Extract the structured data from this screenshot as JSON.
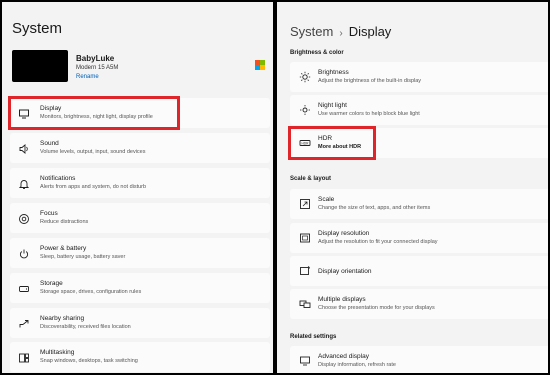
{
  "left": {
    "title": "System",
    "device": {
      "name": "BabyLuke",
      "model": "Modern 15 A5M",
      "rename": "Rename"
    },
    "items": [
      {
        "title": "Display",
        "subtitle": "Monitors, brightness, night light, display profile",
        "icon": "monitor-icon"
      },
      {
        "title": "Sound",
        "subtitle": "Volume levels, output, input, sound devices",
        "icon": "speaker-icon"
      },
      {
        "title": "Notifications",
        "subtitle": "Alerts from apps and system, do not disturb",
        "icon": "bell-icon"
      },
      {
        "title": "Focus",
        "subtitle": "Reduce distractions",
        "icon": "focus-icon"
      },
      {
        "title": "Power & battery",
        "subtitle": "Sleep, battery usage, battery saver",
        "icon": "power-icon"
      },
      {
        "title": "Storage",
        "subtitle": "Storage space, drives, configuration rules",
        "icon": "storage-icon"
      },
      {
        "title": "Nearby sharing",
        "subtitle": "Discoverability, received files location",
        "icon": "share-icon"
      },
      {
        "title": "Multitasking",
        "subtitle": "Snap windows, desktops, task switching",
        "icon": "multitask-icon"
      }
    ]
  },
  "right": {
    "breadcrumb": {
      "parent": "System",
      "separator": "›",
      "current": "Display"
    },
    "sections": {
      "brightness": "Brightness & color",
      "scale": "Scale & layout",
      "related": "Related settings"
    },
    "brightness_items": [
      {
        "title": "Brightness",
        "subtitle": "Adjust the brightness of the built-in display",
        "icon": "sun-icon"
      },
      {
        "title": "Night light",
        "subtitle": "Use warmer colors to help block blue light",
        "icon": "night-light-icon"
      },
      {
        "title": "HDR",
        "link": "More about HDR",
        "icon": "hdr-icon"
      }
    ],
    "scale_items": [
      {
        "title": "Scale",
        "subtitle": "Change the size of text, apps, and other items",
        "icon": "scale-icon"
      },
      {
        "title": "Display resolution",
        "subtitle": "Adjust the resolution to fit your connected display",
        "icon": "resolution-icon"
      },
      {
        "title": "Display orientation",
        "icon": "orientation-icon"
      },
      {
        "title": "Multiple displays",
        "subtitle": "Choose the presentation mode for your displays",
        "icon": "multiple-displays-icon"
      }
    ],
    "related_items": [
      {
        "title": "Advanced display",
        "subtitle": "Display information, refresh rate",
        "icon": "advanced-display-icon"
      }
    ]
  },
  "colors": {
    "highlight": "#e0252a",
    "link": "#005fb8",
    "background": "#f3f3f3",
    "card": "#fbfbfb"
  }
}
